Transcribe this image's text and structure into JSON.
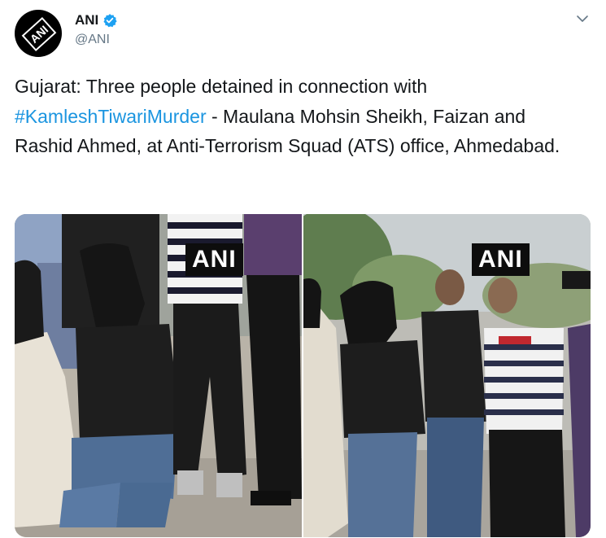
{
  "account": {
    "display_name": "ANI",
    "handle": "@ANI",
    "avatar_logo": "ANI",
    "verified": true
  },
  "tweet": {
    "text_lead": "Gujarat: Three people detained in connection with ",
    "hashtag": "#KamleshTiwariMurder",
    "text_tail": " - Maulana Mohsin Sheikh, Faizan and Rashid Ahmed, at Anti-Terrorism Squad (ATS) office, Ahmedabad."
  },
  "media": [
    {
      "watermark": "ANI"
    },
    {
      "watermark": "ANI"
    }
  ],
  "icons": {
    "verified": "verified-badge-icon",
    "menu": "chevron-down-icon"
  },
  "colors": {
    "link": "#1b95e0",
    "verified": "#1da1f2",
    "secondary_text": "#657786"
  }
}
